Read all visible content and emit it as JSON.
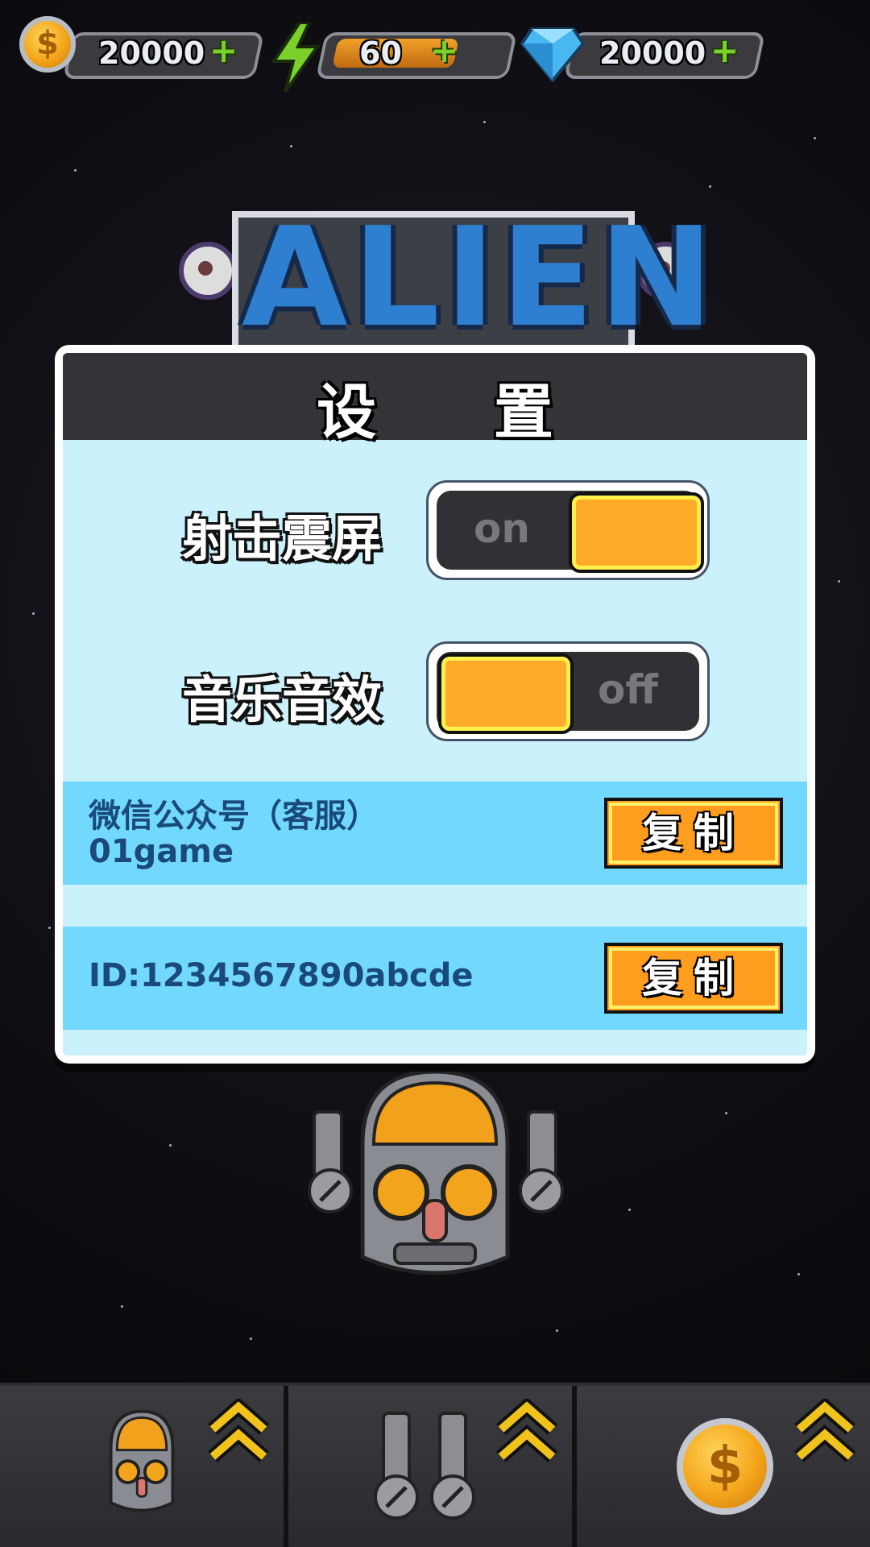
{
  "resources": {
    "coins": {
      "value": "20000",
      "icon": "coin-icon",
      "add_icon": "plus-icon"
    },
    "energy": {
      "value": "60",
      "icon": "lightning-icon",
      "add_icon": "plus-icon"
    },
    "gems": {
      "value": "20000",
      "icon": "diamond-icon",
      "add_icon": "plus-icon"
    }
  },
  "logo": {
    "text": "ALIEN"
  },
  "settings": {
    "title": "设 置",
    "shake_label": "射击震屏",
    "shake_toggle": {
      "text": "on",
      "state": "on"
    },
    "sound_label": "音乐音效",
    "sound_toggle": {
      "text": "off",
      "state": "off"
    },
    "wechat_label": "微信公众号（客服）",
    "wechat_value": "01game",
    "id_text": "ID:1234567890abcde",
    "copy_label": "复制"
  },
  "bottom_bar": {
    "slots": [
      {
        "icon": "robot-ship-icon",
        "action": "upgrade-chevron-icon"
      },
      {
        "icon": "twin-cannons-icon",
        "action": "upgrade-chevron-icon"
      },
      {
        "icon": "coin-icon",
        "action": "upgrade-chevron-icon"
      }
    ]
  },
  "colors": {
    "accent": "#ffab2a",
    "panel": "#cbf1fd",
    "row": "#72d8fe",
    "header": "#333338"
  }
}
